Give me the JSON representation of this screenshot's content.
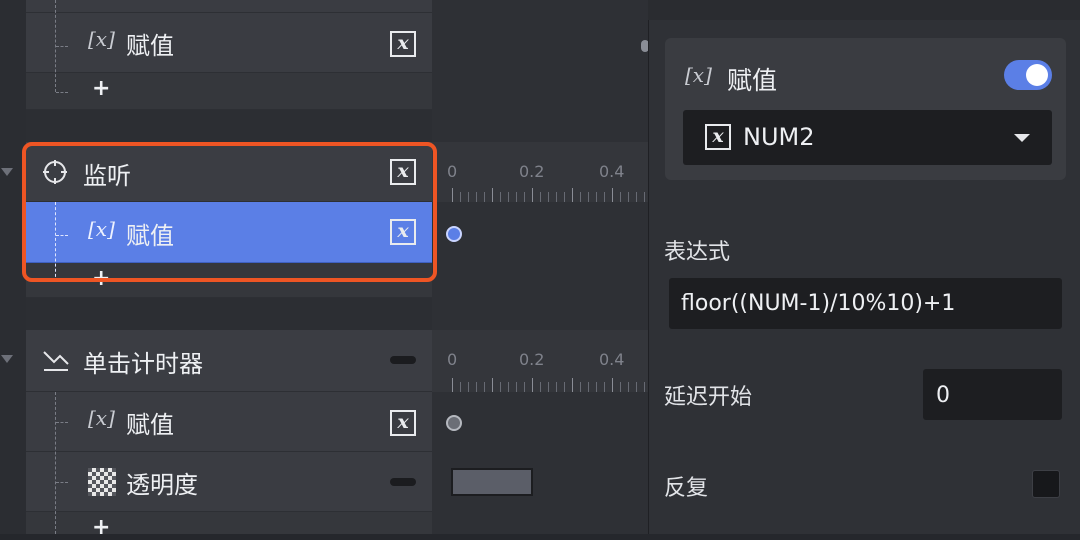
{
  "layers": {
    "group0": {
      "assign_label": "赋值",
      "add_label": "+"
    },
    "listen": {
      "title": "监听",
      "assign_label": "赋值",
      "add_label": "+"
    },
    "click_timer": {
      "title": "单击计时器",
      "assign_label": "赋值",
      "opacity_label": "透明度",
      "add_label": "+"
    }
  },
  "icons": {
    "x_inline": "[x]",
    "x_box": "x",
    "listen": "target-icon",
    "click_timer": "trend-icon",
    "opacity": "checkerboard-icon"
  },
  "timeline": {
    "ticks": [
      "0",
      "0.2",
      "0.4"
    ]
  },
  "panel": {
    "card_title": "赋值",
    "toggle_on": true,
    "variable_select": "NUM2",
    "expression_label": "表达式",
    "expression_value": "floor((NUM-1)/10%10)+1",
    "delay_label": "延迟开始",
    "delay_value": "0",
    "repeat_label": "反复"
  },
  "colors": {
    "accent": "#5b7fe6",
    "highlight": "#ee5524"
  }
}
